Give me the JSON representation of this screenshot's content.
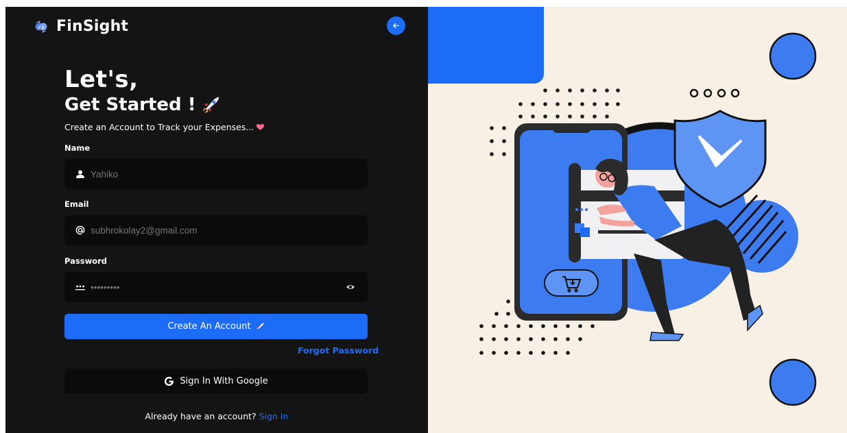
{
  "brand": {
    "name": "FinSight",
    "icon": "currency-exchange-icon"
  },
  "back_button": {
    "icon": "arrow-left-icon"
  },
  "heading": {
    "line1": "Let's,",
    "line2": "Get Started !",
    "line2_icon": "rocket-icon"
  },
  "subtitle": {
    "text": "Create an Account to Track your Expenses...",
    "icon": "heart-icon"
  },
  "form": {
    "name": {
      "label": "Name",
      "value": "",
      "placeholder": "Yahiko",
      "icon": "user-icon"
    },
    "email": {
      "label": "Email",
      "value": "",
      "placeholder": "subhrokolay2@gmail.com",
      "icon": "at-icon"
    },
    "password": {
      "label": "Password",
      "value": "",
      "placeholder": "•••••••••",
      "icon": "password-dots-icon",
      "toggle_icon": "eye-icon"
    },
    "submit_label": "Create An Account",
    "submit_icon": "rocket-icon",
    "forgot_label": "Forgot Password"
  },
  "google": {
    "label": "Sign In With Google",
    "icon": "google-g-icon"
  },
  "signin": {
    "prompt": "Already have an account?",
    "link": "Sign In"
  },
  "colors": {
    "accent": "#1c6cf7",
    "panel": "#141414",
    "field": "#0b0b0b",
    "illustration_bg": "#f8efe5",
    "illustration_blue": "#3d7cf0"
  }
}
